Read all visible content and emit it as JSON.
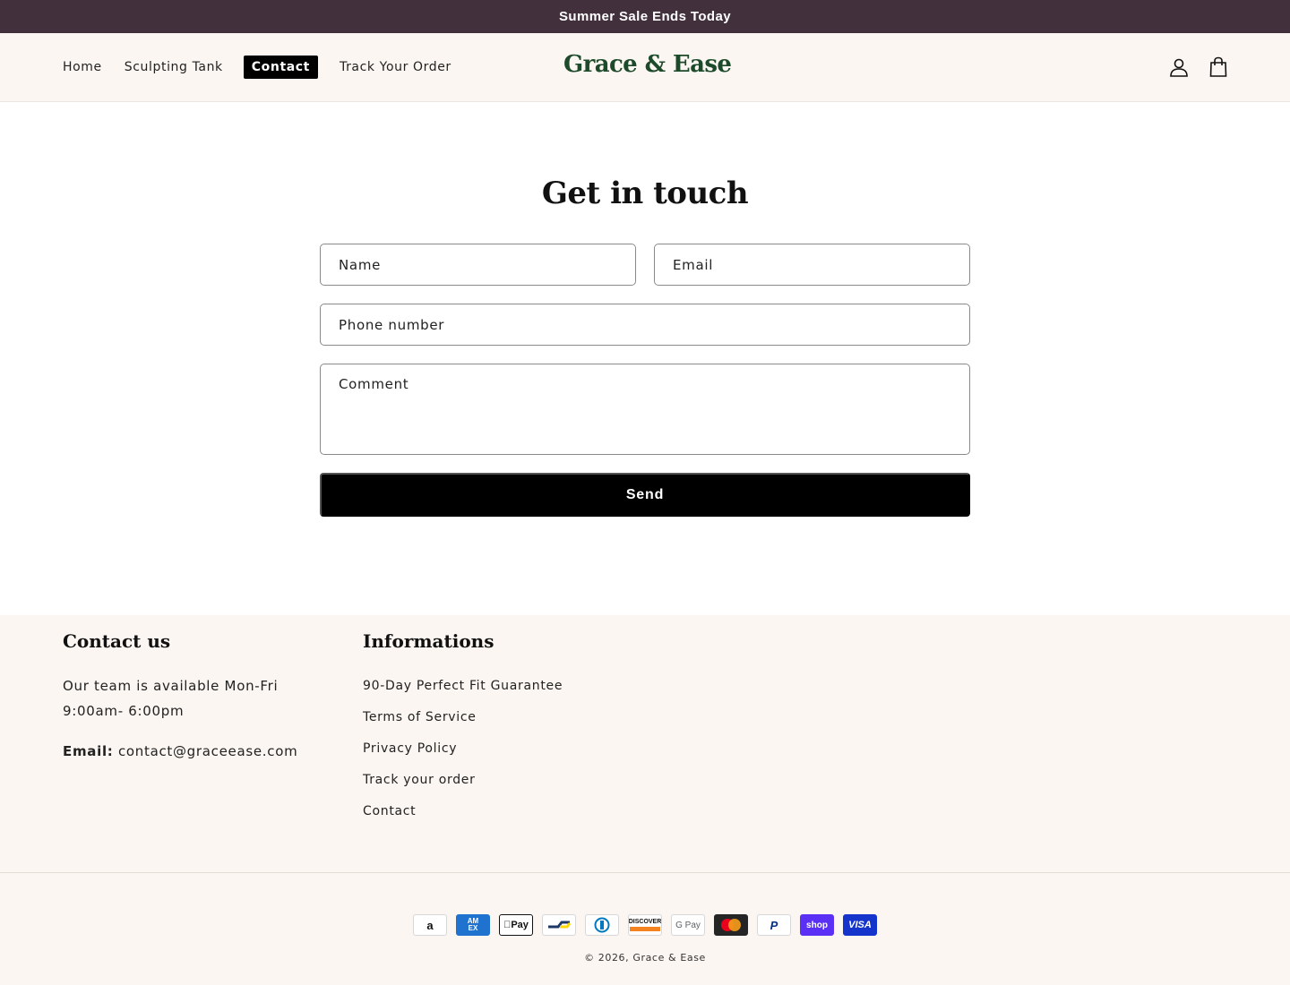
{
  "announcement": "Summer Sale Ends Today",
  "header": {
    "nav": [
      {
        "label": "Home"
      },
      {
        "label": "Sculpting Tank"
      },
      {
        "label": "Contact",
        "active": true
      },
      {
        "label": "Track Your Order"
      }
    ],
    "logo": "Grace & Ease",
    "icons": [
      "account-icon",
      "cart-icon"
    ]
  },
  "contact_form": {
    "title": "Get in touch",
    "name_placeholder": "Name",
    "email_placeholder": "Email",
    "phone_placeholder": "Phone number",
    "comment_placeholder": "Comment",
    "send_label": "Send"
  },
  "footer": {
    "contact": {
      "heading": "Contact us",
      "availability": [
        "Our team is available Mon-Fri",
        "9:00am- 6:00pm"
      ],
      "email_label": "Email:",
      "email": "contact@graceease.com"
    },
    "informations": {
      "heading": "Informations",
      "links": [
        "90-Day Perfect Fit Guarantee",
        "Terms of Service",
        "Privacy Policy",
        "Track your order",
        "Contact"
      ]
    },
    "payment_methods": [
      {
        "name": "Amazon",
        "icon": "amazon-pay-icon",
        "label": "a"
      },
      {
        "name": "American Express",
        "icon": "amex-icon",
        "label": "AM EX",
        "color": "#1f72cd"
      },
      {
        "name": "Apple Pay",
        "icon": "apple-pay-icon",
        "label": "Pay"
      },
      {
        "name": "Bancontact",
        "icon": "bancontact-icon",
        "label": ""
      },
      {
        "name": "Diners Club",
        "icon": "diners-club-icon",
        "label": ""
      },
      {
        "name": "Discover",
        "icon": "discover-icon",
        "label": "DISCOVER"
      },
      {
        "name": "Google Pay",
        "icon": "google-pay-icon",
        "label": "G Pay"
      },
      {
        "name": "Mastercard",
        "icon": "mastercard-icon",
        "label": ""
      },
      {
        "name": "PayPal",
        "icon": "paypal-icon",
        "label": "P"
      },
      {
        "name": "Shop Pay",
        "icon": "shop-pay-icon",
        "label": "shop",
        "color": "#5a31f4"
      },
      {
        "name": "Visa",
        "icon": "visa-icon",
        "label": "VISA",
        "color": "#1434cb"
      }
    ],
    "copyright": "© 2026, Grace & Ease"
  },
  "colors": {
    "announcement_bg": "#42303d",
    "header_bg": "#fbf6f1",
    "logo": "#1d4a2a",
    "button": "#000000"
  }
}
